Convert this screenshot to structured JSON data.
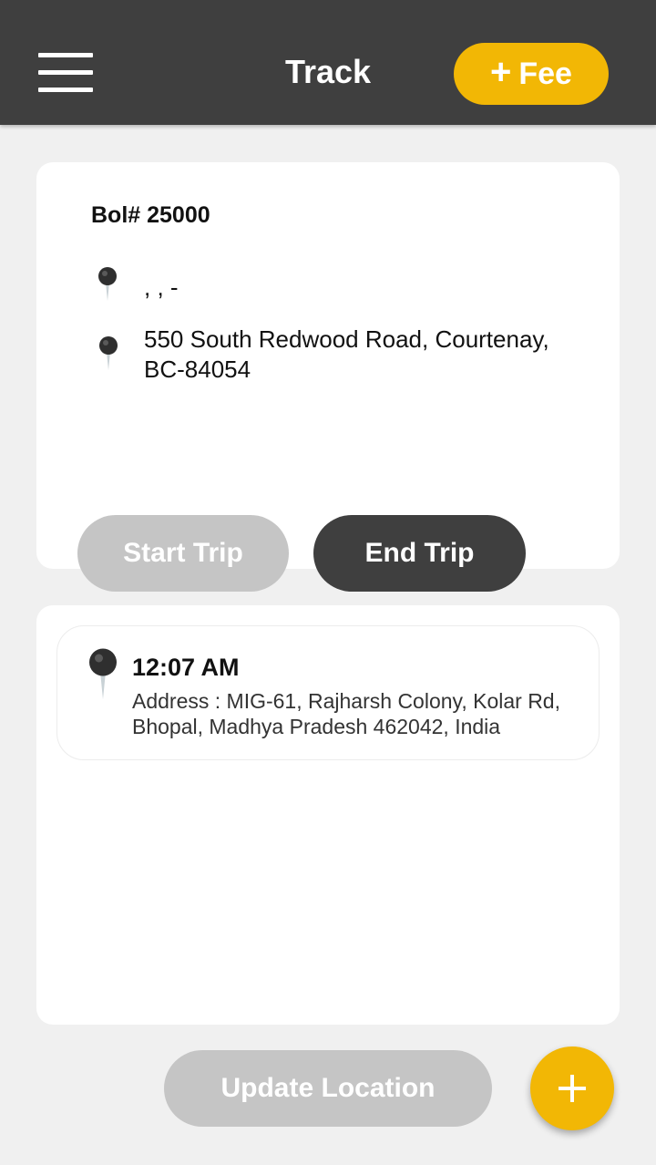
{
  "header": {
    "title": "Track",
    "fee_button_label": "Fee",
    "fee_button_icon": "plus-icon",
    "menu_icon": "hamburger-menu-icon"
  },
  "trip": {
    "bol_label": "Bol# 25000",
    "origin_address": ", , -",
    "destination_address": "550 South Redwood Road, Courtenay, BC-84054",
    "start_button_label": "Start Trip",
    "end_button_label": "End Trip"
  },
  "location_log": [
    {
      "time": "12:07 AM",
      "address": "Address : MIG-61, Rajharsh Colony, Kolar Rd, Bhopal, Madhya Pradesh 462042, India"
    }
  ],
  "footer": {
    "update_button_label": "Update Location",
    "fab_icon": "plus-icon"
  },
  "colors": {
    "header_bg": "#3f3f3f",
    "accent": "#f2b705",
    "disabled_button": "#c5c5c5",
    "dark_button": "#3f3f3f",
    "page_bg": "#f0f0f0"
  }
}
